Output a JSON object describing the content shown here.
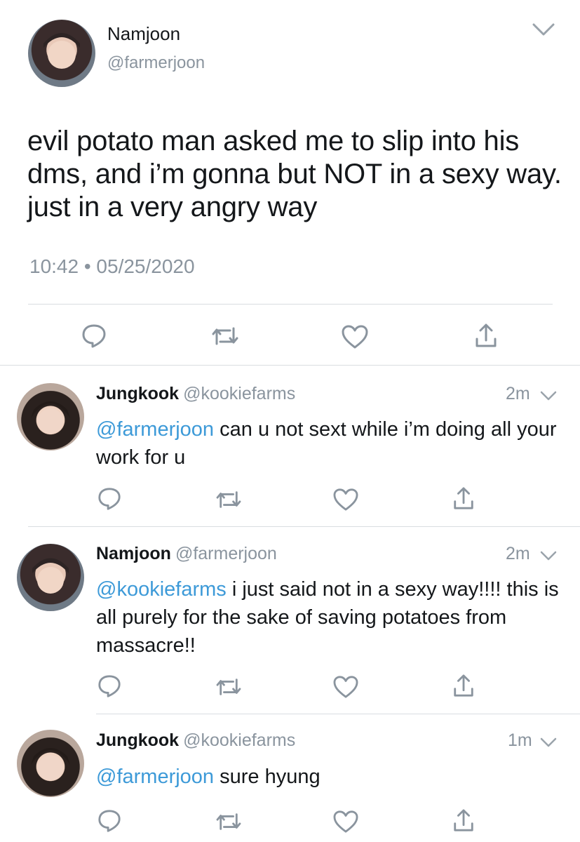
{
  "main_tweet": {
    "author_name": "Namjoon",
    "author_handle": "@farmerjoon",
    "text": "evil potato man asked me to slip into his dms, and i’m gonna but NOT in a sexy way. just in a very angry way",
    "timestamp": "10:42 • 05/25/2020",
    "avatar_icon": "user-avatar",
    "menu_icon": "chevron-down-icon"
  },
  "replies": [
    {
      "author_name": "Jungkook",
      "author_handle": "@kookiefarms",
      "time": "2m",
      "mention": "@farmerjoon",
      "text": "can u not sext while i’m doing all your work for u"
    },
    {
      "author_name": "Namjoon",
      "author_handle": "@farmerjoon",
      "time": "2m",
      "mention": "@kookiefarms",
      "text": "i just said not in a sexy way!!!! this is all purely for the sake of saving potatoes from massacre!!"
    },
    {
      "author_name": "Jungkook",
      "author_handle": "@kookiefarms",
      "time": "1m",
      "mention": "@farmerjoon",
      "text": "sure hyung"
    }
  ],
  "icons": {
    "reply": "reply-icon",
    "retweet": "retweet-icon",
    "like": "like-icon",
    "share": "share-icon"
  },
  "colors": {
    "text": "#14171a",
    "secondary": "#8a949e",
    "mention": "#3d9ad8",
    "divider": "#d9dde1",
    "icon": "#8a949e"
  }
}
